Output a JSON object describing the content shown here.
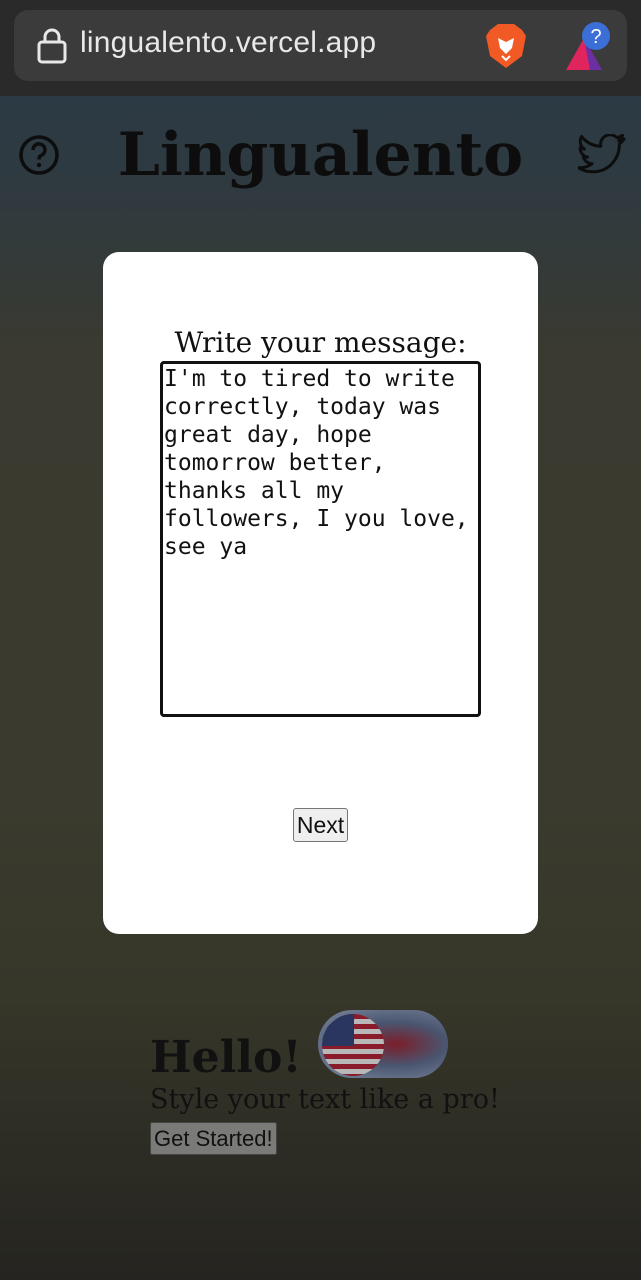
{
  "browser": {
    "url": "lingualento.vercel.app",
    "icons": [
      "lock-icon",
      "brave-lion-icon",
      "brave-rewards-icon"
    ],
    "rewards_badge": "?"
  },
  "site": {
    "title": "Lingualento",
    "icons": [
      "help-icon",
      "twitter-icon"
    ]
  },
  "background_hero": {
    "heading": "Hello!",
    "subtitle": "Style your text like a pro!",
    "cta_label": "Get Started!",
    "language_toggle_flag": "us-flag"
  },
  "modal": {
    "prompt": "Write your message:",
    "message_value": "I'm to tired to write correctly, today was great day, hope tomorrow better, thanks all my followers, I you love, see ya",
    "next_label": "Next"
  },
  "colors": {
    "modal_bg": "#ffffff",
    "overlay_tint": "#3a3a2e",
    "twitter_icon": "#111111"
  }
}
